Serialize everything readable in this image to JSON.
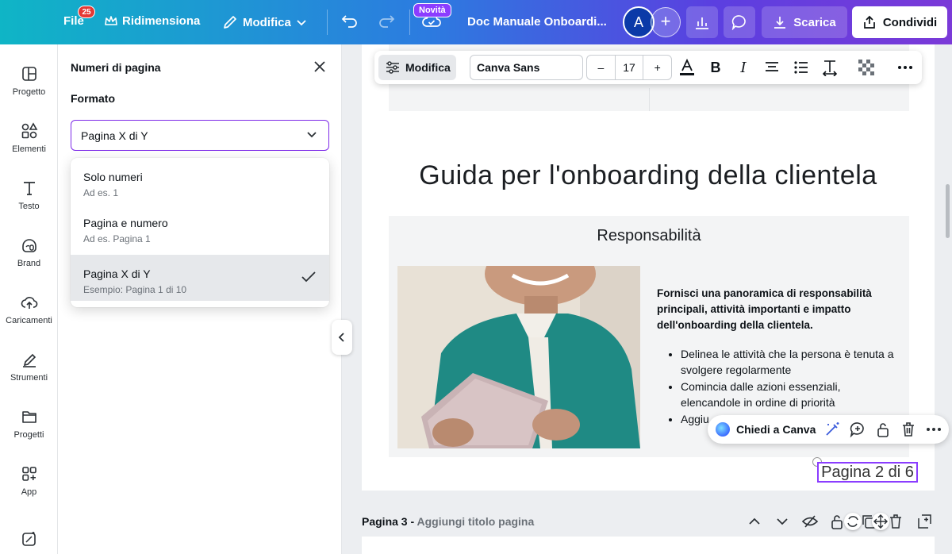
{
  "topbar": {
    "file_label": "File",
    "file_badge": "25",
    "resize_label": "Ridimensiona",
    "edit_label": "Modifica",
    "new_badge": "Novità",
    "doc_title": "Doc Manuale Onboardi...",
    "avatar_initial": "A",
    "download_label": "Scarica",
    "share_label": "Condividi"
  },
  "rail": {
    "items": [
      {
        "label": "Progetto",
        "icon": "layout-icon"
      },
      {
        "label": "Elementi",
        "icon": "shapes-icon"
      },
      {
        "label": "Testo",
        "icon": "text-icon"
      },
      {
        "label": "Brand",
        "icon": "brand-icon"
      },
      {
        "label": "Caricamenti",
        "icon": "upload-cloud-icon"
      },
      {
        "label": "Strumenti",
        "icon": "pen-tool-icon"
      },
      {
        "label": "Progetti",
        "icon": "folder-icon"
      },
      {
        "label": "App",
        "icon": "apps-icon"
      }
    ]
  },
  "panel": {
    "title": "Numeri di pagina",
    "format_label": "Formato",
    "selected_value": "Pagina X di Y",
    "options": [
      {
        "title": "Solo numeri",
        "example": "Ad es. 1"
      },
      {
        "title": "Pagina e numero",
        "example": "Ad es. Pagina 1"
      },
      {
        "title": "Pagina X di Y",
        "example": "Esempio: Pagina 1 di 10"
      }
    ]
  },
  "toolbar": {
    "edit_label": "Modifica",
    "font_name": "Canva Sans",
    "font_size": "17",
    "minus": "–",
    "plus": "+"
  },
  "document": {
    "heading": "Guida per l'onboarding della clientela",
    "section_title": "Responsabilità",
    "intro": "Fornisci una panoramica di responsabilità principali, attività importanti e impatto dell'onboarding della clientela.",
    "bullets": [
      "Delinea le attività che la persona è tenuta a svolgere regolarmente",
      "Comincia dalle azioni essenziali, elencandole in ordine di priorità",
      "Aggiu"
    ],
    "page_number_text": "Pagina 2 di 6"
  },
  "ask_bar": {
    "label": "Chiedi a Canva"
  },
  "page3": {
    "label": "Pagina 3 -",
    "placeholder": "Aggiungi titolo pagina"
  },
  "colors": {
    "accent": "#8b3dff",
    "selection_border": "#7d2ae8",
    "topbar_start": "#0fb5c6",
    "topbar_end": "#7b3ad8"
  }
}
